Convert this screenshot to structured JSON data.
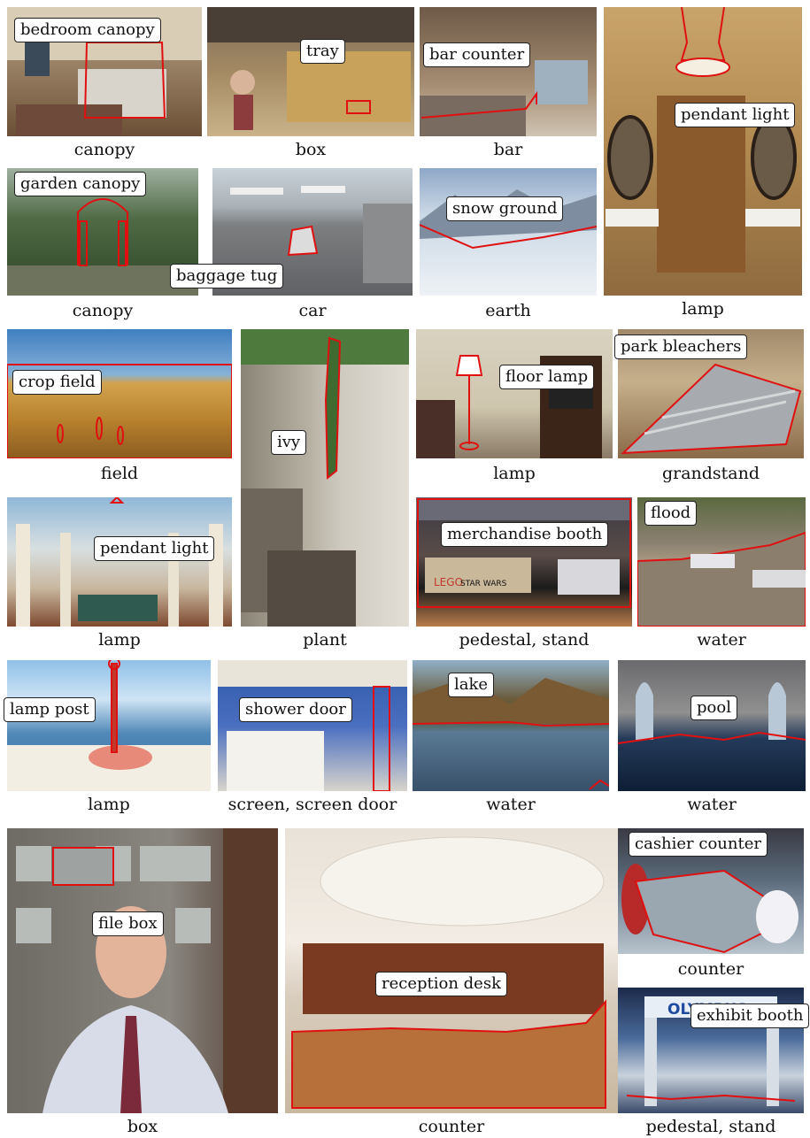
{
  "tiles": [
    {
      "caption": "canopy",
      "label": "bedroom canopy"
    },
    {
      "caption": "box",
      "label": "tray"
    },
    {
      "caption": "bar",
      "label": "bar counter"
    },
    {
      "caption": "lamp",
      "label": "pendant light"
    },
    {
      "caption": "canopy",
      "label": "garden canopy"
    },
    {
      "caption": "car",
      "label": "baggage tug"
    },
    {
      "caption": "earth",
      "label": "snow ground"
    },
    {
      "caption": "field",
      "label": "crop field"
    },
    {
      "caption": "plant",
      "label": "ivy"
    },
    {
      "caption": "lamp",
      "label": "floor lamp"
    },
    {
      "caption": "grandstand",
      "label": "park bleachers"
    },
    {
      "caption": "lamp",
      "label": "pendant light"
    },
    {
      "caption": "pedestal, stand",
      "label": "merchandise booth"
    },
    {
      "caption": "water",
      "label": "flood"
    },
    {
      "caption": "lamp",
      "label": "lamp post"
    },
    {
      "caption": "screen, screen door",
      "label": "shower door"
    },
    {
      "caption": "water",
      "label": "lake"
    },
    {
      "caption": "water",
      "label": "pool"
    },
    {
      "caption": "box",
      "label": "file box"
    },
    {
      "caption": "counter",
      "label": "reception desk"
    },
    {
      "caption": "counter",
      "label": "cashier counter"
    },
    {
      "caption": "pedestal, stand",
      "label": "exhibit booth"
    }
  ],
  "photo_text": {
    "olympus": "OLYMPUS",
    "lego": "LEGO",
    "star_wars": "STAR WARS"
  },
  "colors": {
    "outline": "#e01010",
    "callout_border": "#222222"
  }
}
